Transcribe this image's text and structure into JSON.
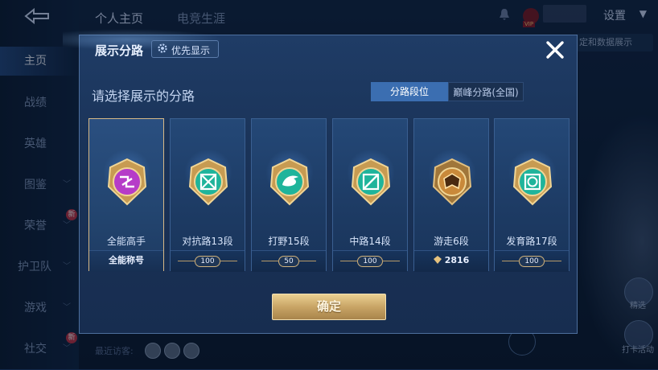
{
  "background": {
    "top_tabs": [
      "个人主页",
      "电竞生涯"
    ],
    "sidebar": [
      {
        "label": "主页",
        "active": true
      },
      {
        "label": "战绩"
      },
      {
        "label": "英雄"
      },
      {
        "label": "图鉴"
      },
      {
        "label": "荣誉",
        "badge": "新"
      },
      {
        "label": "护卫队"
      },
      {
        "label": "游戏"
      },
      {
        "label": "社交",
        "badge": "新"
      }
    ],
    "settings_label": "设置",
    "right_chip": "定和数据展示",
    "vip_label": "VIP",
    "right_labels": [
      "精选",
      "打卡活动"
    ],
    "bottom_text": "最近访客:"
  },
  "modal": {
    "title": "展示分路",
    "priority_button": "优先显示",
    "subtitle": "请选择展示的分路",
    "segments": [
      "分路段位",
      "巅峰分路(全国)"
    ],
    "confirm_button": "确定",
    "cards": [
      {
        "name": "全能高手",
        "footer": "全能称号",
        "footer_type": "text",
        "selected": true,
        "color": "#b63cc8"
      },
      {
        "name": "对抗路13段",
        "footer": "100",
        "footer_type": "pill",
        "color": "#1fb49b"
      },
      {
        "name": "打野15段",
        "footer": "50",
        "footer_type": "pill",
        "color": "#1fb49b"
      },
      {
        "name": "中路14段",
        "footer": "100",
        "footer_type": "pill",
        "color": "#1fb49b"
      },
      {
        "name": "游走6段",
        "footer": "2816",
        "footer_type": "peak",
        "color": "#c9893a"
      },
      {
        "name": "发育路17段",
        "footer": "100",
        "footer_type": "pill",
        "color": "#1fb49b"
      }
    ]
  },
  "colors": {
    "accent": "#3b6eb1",
    "gold": "#d8b986",
    "teal": "#1fb49b",
    "purple": "#b63cc8"
  }
}
